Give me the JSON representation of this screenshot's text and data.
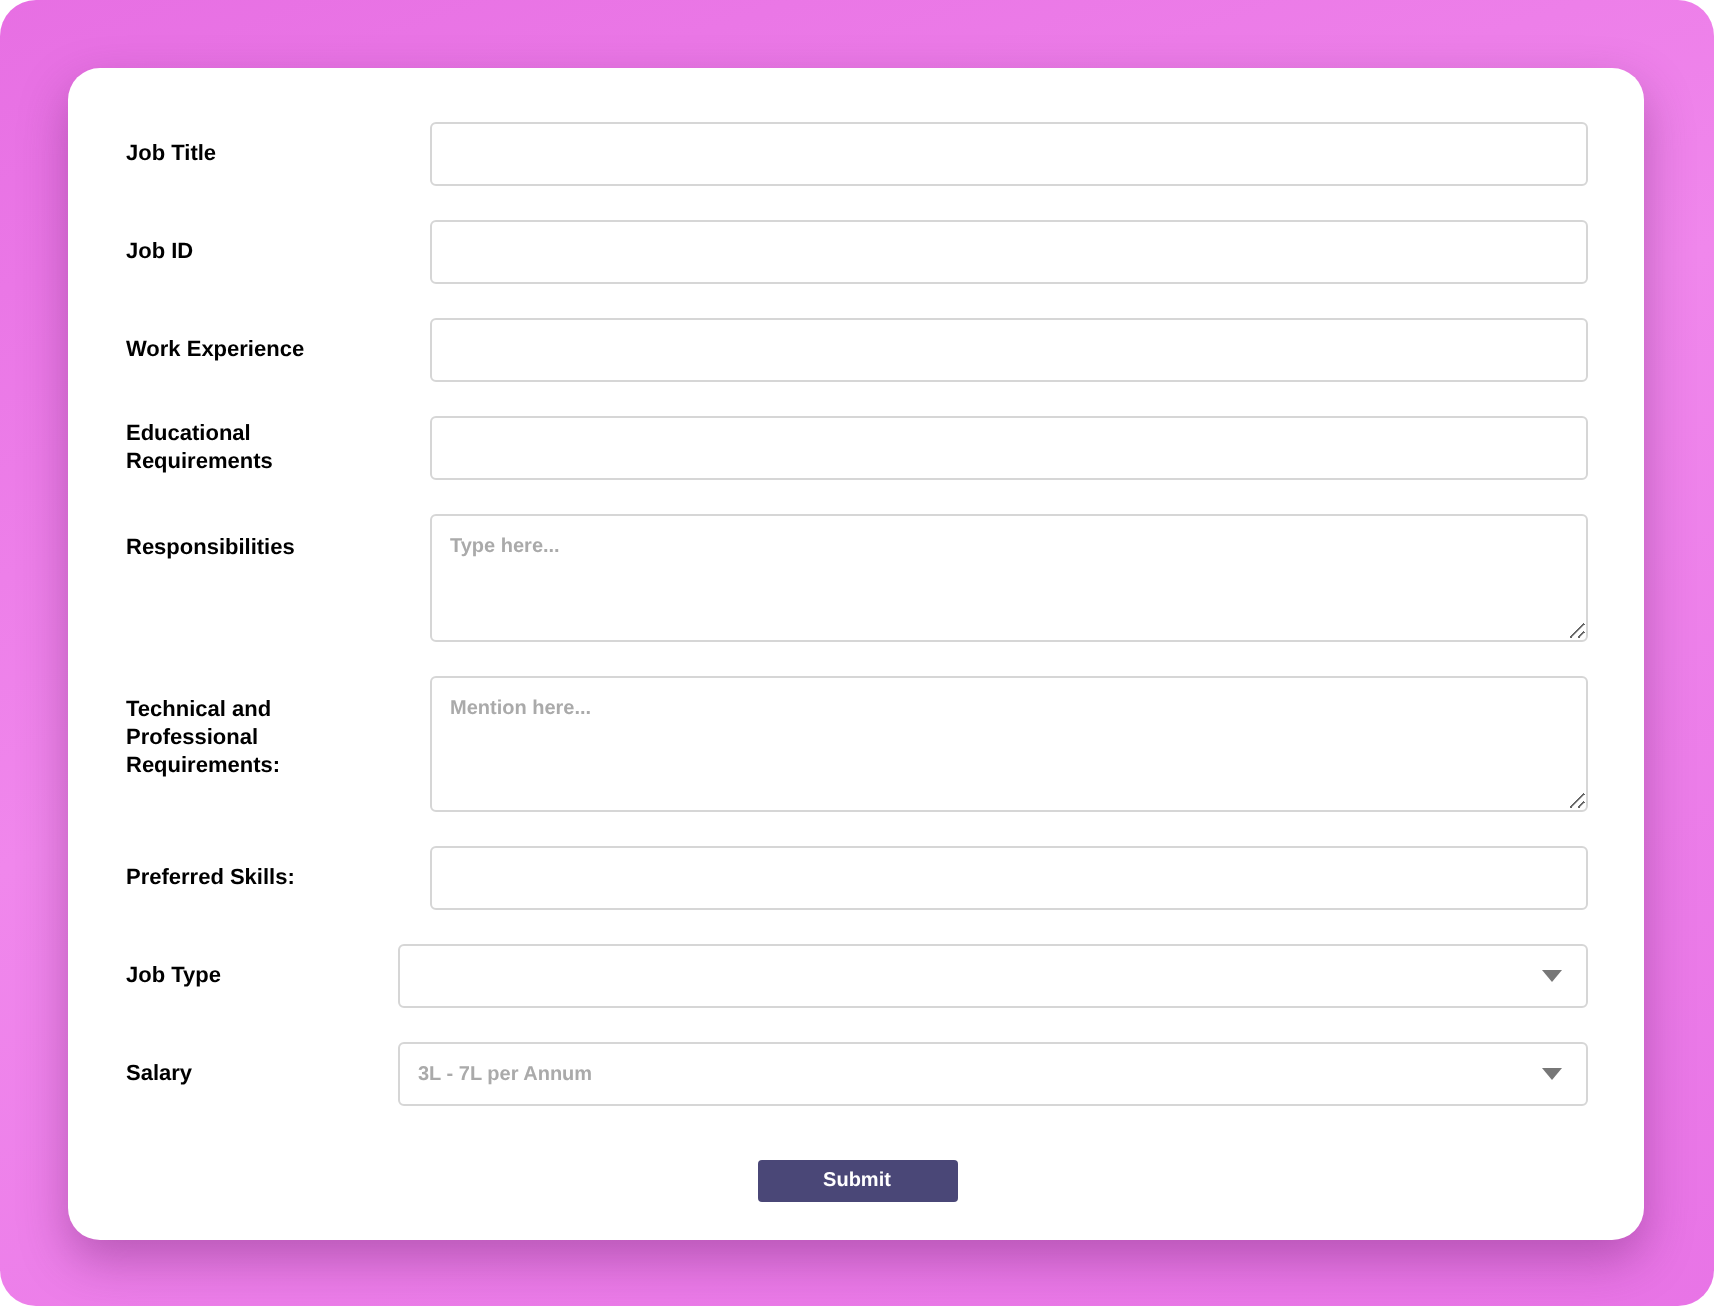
{
  "fields": [
    {
      "label": "Job Title",
      "kind": "input"
    },
    {
      "label": "Job ID",
      "kind": "input"
    },
    {
      "label": "Work Experience",
      "kind": "input"
    },
    {
      "label": "Educational Requirements",
      "kind": "input"
    },
    {
      "label": "Responsibilities",
      "kind": "textarea",
      "placeholder": "Type here..."
    },
    {
      "label": "Technical and Professional Requirements:",
      "kind": "textarea",
      "placeholder": "Mention here..."
    },
    {
      "label": "Preferred Skills:",
      "kind": "input"
    },
    {
      "label": "Job Type",
      "kind": "select"
    },
    {
      "label": "Salary",
      "kind": "select",
      "placeholder": "3L - 7L per Annum"
    }
  ],
  "submit": "Submit"
}
